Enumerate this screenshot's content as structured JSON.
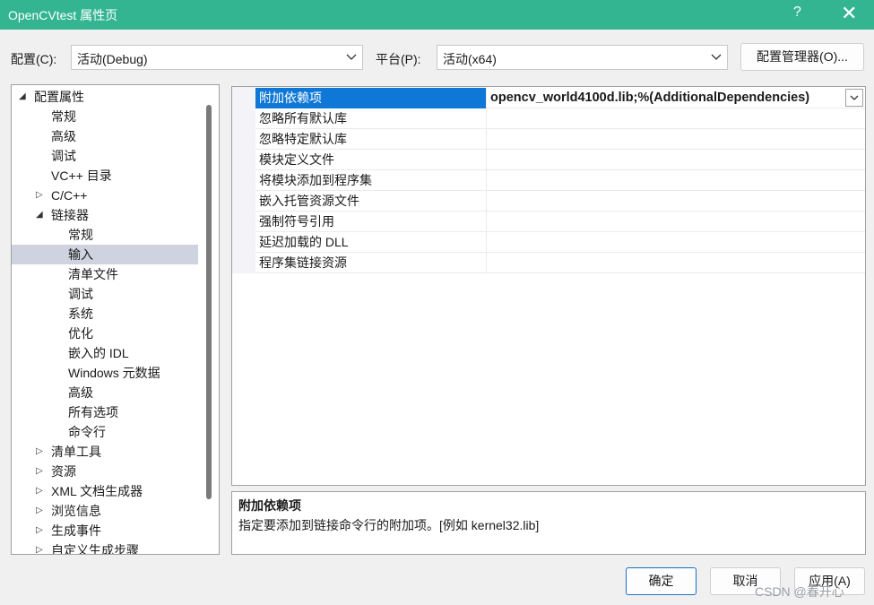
{
  "window": {
    "title": "OpenCVtest 属性页",
    "help_label": "?",
    "close_label": "✕",
    "title_bar_color": "#34b592"
  },
  "config": {
    "config_label": "配置(C):",
    "config_value": "活动(Debug)",
    "platform_label": "平台(P):",
    "platform_value": "活动(x64)",
    "manager_button": "配置管理器(O)..."
  },
  "tree": {
    "items": [
      {
        "label": "配置属性",
        "twisty": "◢"
      },
      {
        "label": "常规"
      },
      {
        "label": "高级"
      },
      {
        "label": "调试"
      },
      {
        "label": "VC++ 目录"
      },
      {
        "label": "C/C++",
        "twisty": "▷"
      },
      {
        "label": "链接器",
        "twisty": "◢"
      },
      {
        "label": "常规"
      },
      {
        "label": "输入"
      },
      {
        "label": "清单文件"
      },
      {
        "label": "调试"
      },
      {
        "label": "系统"
      },
      {
        "label": "优化"
      },
      {
        "label": "嵌入的 IDL"
      },
      {
        "label": "Windows 元数据"
      },
      {
        "label": "高级"
      },
      {
        "label": "所有选项"
      },
      {
        "label": "命令行"
      },
      {
        "label": "清单工具",
        "twisty": "▷"
      },
      {
        "label": "资源",
        "twisty": "▷"
      },
      {
        "label": "XML 文档生成器",
        "twisty": "▷"
      },
      {
        "label": "浏览信息",
        "twisty": "▷"
      },
      {
        "label": "生成事件",
        "twisty": "▷"
      },
      {
        "label": "自定义生成步骤",
        "twisty": "▷"
      }
    ],
    "selected_label": "输入"
  },
  "properties": {
    "rows": [
      {
        "name": "附加依赖项",
        "value": "opencv_world4100d.lib;%(AdditionalDependencies)"
      },
      {
        "name": "忽略所有默认库",
        "value": ""
      },
      {
        "name": "忽略特定默认库",
        "value": ""
      },
      {
        "name": "模块定义文件",
        "value": ""
      },
      {
        "name": "将模块添加到程序集",
        "value": ""
      },
      {
        "name": "嵌入托管资源文件",
        "value": ""
      },
      {
        "name": "强制符号引用",
        "value": ""
      },
      {
        "name": "延迟加载的 DLL",
        "value": ""
      },
      {
        "name": "程序集链接资源",
        "value": ""
      }
    ],
    "selected_name": "附加依赖项"
  },
  "description": {
    "title": "附加依赖项",
    "text": "指定要添加到链接命令行的附加项。[例如 kernel32.lib]"
  },
  "buttons": {
    "ok": "确定",
    "cancel": "取消",
    "apply": "应用(A)"
  },
  "watermark": "CSDN @春开心",
  "colors": {
    "selection_blue": "#0f78d7",
    "tree_selection": "#cfd3df"
  }
}
